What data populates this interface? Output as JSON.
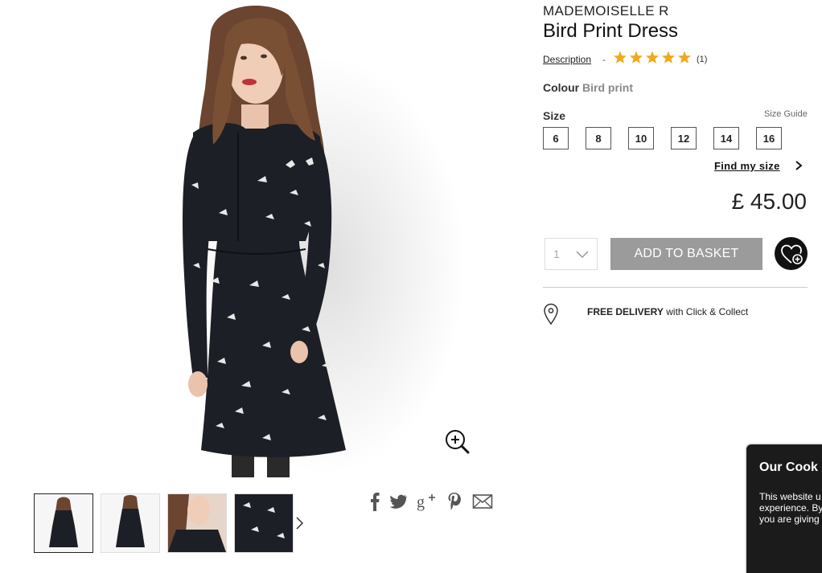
{
  "product": {
    "brand": "MADEMOISELLE R",
    "title": "Bird Print Dress",
    "description_link": "Description",
    "separator": "-",
    "rating_stars": 5,
    "review_count": "(1)",
    "colour_label": "Colour",
    "colour_value": "Bird print",
    "size_label": "Size",
    "size_guide": "Size Guide",
    "sizes": [
      "6",
      "8",
      "10",
      "12",
      "14",
      "16"
    ],
    "find_my_size": "Find my size",
    "price": "£ 45.00",
    "quantity": "1",
    "add_to_basket": "ADD TO BASKET",
    "delivery_bold": "FREE DELIVERY",
    "delivery_rest": " with Click & Collect"
  },
  "gallery": {
    "thumbnails": [
      "front-view",
      "back-view",
      "neckline-detail",
      "print-detail"
    ],
    "active_index": 0
  },
  "share_icons": [
    "facebook-icon",
    "twitter-icon",
    "google-plus-icon",
    "pinterest-icon",
    "email-icon"
  ],
  "cookie": {
    "title": "Our Cook",
    "lines": [
      "This website u",
      "experience. By",
      "you are giving"
    ]
  },
  "colors": {
    "accent_star": "#f0a81c",
    "button_gray": "#9b9b9b",
    "dress": "#1c1f26",
    "cookie_bg": "#1b1b1b"
  }
}
